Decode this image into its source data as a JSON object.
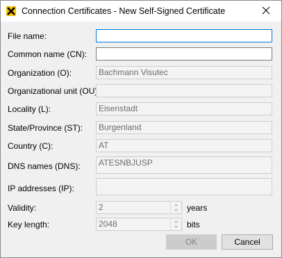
{
  "window": {
    "title": "Connection Certificates - New Self-Signed Certificate",
    "app_icon": "bachmann-x-icon",
    "close_icon": "close-icon"
  },
  "form": {
    "file_name": {
      "label": "File name:",
      "value": ""
    },
    "common_name": {
      "label": "Common name (CN):",
      "value": ""
    },
    "organization": {
      "label": "Organization (O):",
      "value": "Bachmann Visutec"
    },
    "organizational_unit": {
      "label": "Organizational unit (OU):",
      "value": ""
    },
    "locality": {
      "label": "Locality (L):",
      "value": "Eisenstadt"
    },
    "state_province": {
      "label": "State/Province (ST):",
      "value": "Burgenland"
    },
    "country": {
      "label": "Country (C):",
      "value": "AT"
    },
    "dns_names": {
      "label": "DNS names (DNS):",
      "value": "ATESNBJUSP"
    },
    "ip_addresses": {
      "label": "IP addresses (IP):",
      "value": ""
    },
    "validity": {
      "label": "Validity:",
      "value": "2",
      "unit": "years"
    },
    "key_length": {
      "label": "Key length:",
      "value": "2048",
      "unit": "bits"
    }
  },
  "buttons": {
    "ok": "OK",
    "cancel": "Cancel"
  },
  "colors": {
    "focus_border": "#0078d7",
    "icon_yellow": "#f5c400",
    "disabled_text": "#6d6d6d"
  }
}
